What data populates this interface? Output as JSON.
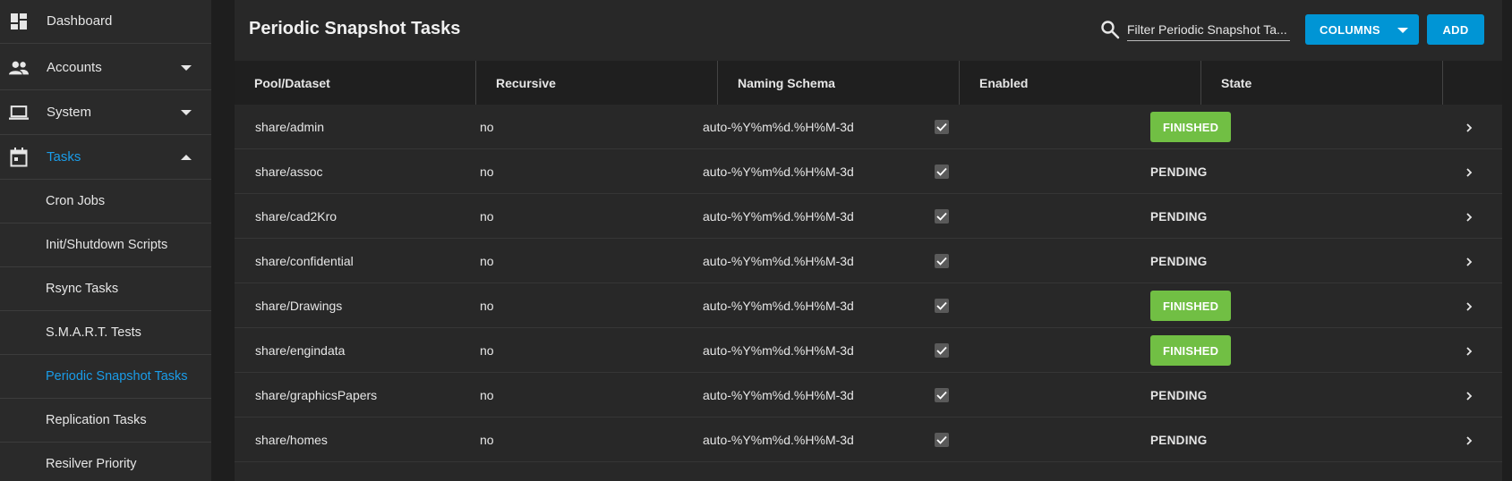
{
  "sidebar": {
    "items": [
      {
        "label": "Dashboard",
        "icon": "dashboard-icon",
        "caret": "none",
        "active": false
      },
      {
        "label": "Accounts",
        "icon": "people-icon",
        "caret": "down",
        "active": false
      },
      {
        "label": "System",
        "icon": "laptop-icon",
        "caret": "down",
        "active": false
      },
      {
        "label": "Tasks",
        "icon": "calendar-icon",
        "caret": "up",
        "active": true
      }
    ],
    "subitems": [
      {
        "label": "Cron Jobs",
        "active": false
      },
      {
        "label": "Init/Shutdown Scripts",
        "active": false
      },
      {
        "label": "Rsync Tasks",
        "active": false
      },
      {
        "label": "S.M.A.R.T. Tests",
        "active": false
      },
      {
        "label": "Periodic Snapshot Tasks",
        "active": true
      },
      {
        "label": "Replication Tasks",
        "active": false
      },
      {
        "label": "Resilver Priority",
        "active": false
      }
    ]
  },
  "header": {
    "title": "Periodic Snapshot Tasks",
    "search_value": "Filter Periodic Snapshot Ta...",
    "columns_label": "COLUMNS",
    "add_label": "ADD"
  },
  "table": {
    "columns": [
      "Pool/Dataset",
      "Recursive",
      "Naming Schema",
      "Enabled",
      "State"
    ],
    "rows": [
      {
        "dataset": "share/admin",
        "recursive": "no",
        "schema": "auto-%Y%m%d.%H%M-3d",
        "enabled": true,
        "state": "FINISHED"
      },
      {
        "dataset": "share/assoc",
        "recursive": "no",
        "schema": "auto-%Y%m%d.%H%M-3d",
        "enabled": true,
        "state": "PENDING"
      },
      {
        "dataset": "share/cad2Kro",
        "recursive": "no",
        "schema": "auto-%Y%m%d.%H%M-3d",
        "enabled": true,
        "state": "PENDING"
      },
      {
        "dataset": "share/confidential",
        "recursive": "no",
        "schema": "auto-%Y%m%d.%H%M-3d",
        "enabled": true,
        "state": "PENDING"
      },
      {
        "dataset": "share/Drawings",
        "recursive": "no",
        "schema": "auto-%Y%m%d.%H%M-3d",
        "enabled": true,
        "state": "FINISHED"
      },
      {
        "dataset": "share/engindata",
        "recursive": "no",
        "schema": "auto-%Y%m%d.%H%M-3d",
        "enabled": true,
        "state": "FINISHED"
      },
      {
        "dataset": "share/graphicsPapers",
        "recursive": "no",
        "schema": "auto-%Y%m%d.%H%M-3d",
        "enabled": true,
        "state": "PENDING"
      },
      {
        "dataset": "share/homes",
        "recursive": "no",
        "schema": "auto-%Y%m%d.%H%M-3d",
        "enabled": true,
        "state": "PENDING"
      }
    ]
  },
  "colors": {
    "accent": "#0095d5",
    "active_link": "#1a9ce8",
    "finished_badge": "#71bf44"
  }
}
